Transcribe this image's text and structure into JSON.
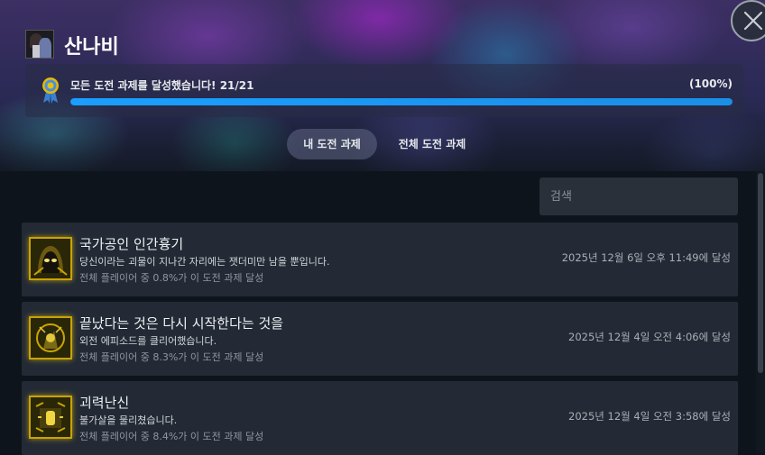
{
  "game": {
    "title": "산나비",
    "icon": "game-logo-icon"
  },
  "progress": {
    "text": "모든 도전 과제를 달성했습니다! 21/21",
    "percent_label": "(100%)",
    "percent": 100,
    "icon": "medal-icon"
  },
  "tabs": [
    {
      "label": "내 도전 과제",
      "active": true
    },
    {
      "label": "전체 도전 과제",
      "active": false
    }
  ],
  "search": {
    "placeholder": "검색",
    "value": ""
  },
  "achievements": [
    {
      "name": "국가공인 인간흉기",
      "description": "당신이라는 괴물이 지나간 자리에는 잿더미만 남을 뿐입니다.",
      "global_pct": "전체 플레이어 중 0.8%가 이 도전 과제 달성",
      "unlocked": "2025년 12월 6일 오후 11:49에 달성"
    },
    {
      "name": "끝났다는 것은 다시 시작한다는 것을",
      "description": "외전 에피소드를 클리어했습니다.",
      "global_pct": "전체 플레이어 중 8.3%가 이 도전 과제 달성",
      "unlocked": "2025년 12월 4일 오전 4:06에 달성"
    },
    {
      "name": "괴력난신",
      "description": "불가살을 물리쳤습니다.",
      "global_pct": "전체 플레이어 중 8.4%가 이 도전 과제 달성",
      "unlocked": "2025년 12월 4일 오전 3:58에 달성"
    }
  ],
  "colors": {
    "accent": "#1a9fff",
    "gold": "#c9a400",
    "row_bg": "#232a35"
  }
}
